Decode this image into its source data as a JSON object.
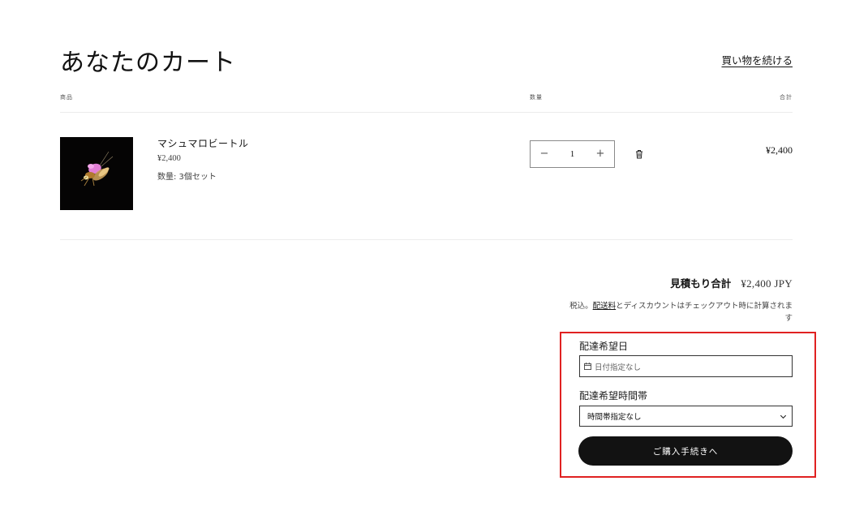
{
  "header": {
    "title": "あなたのカート",
    "continue_link": "買い物を続ける"
  },
  "columns": {
    "product": "商品",
    "quantity": "数量",
    "total": "合計"
  },
  "item": {
    "name": "マシュマロビートル",
    "price": "¥2,400",
    "option": "数量: 3個セット",
    "quantity": "1",
    "decrement_symbol": "−",
    "increment_symbol": "+",
    "line_total": "¥2,400",
    "image_icon": "beetle-photo",
    "remove_icon": "trash-icon"
  },
  "summary": {
    "estimate_label": "見積もり合計",
    "estimate_amount": "¥2,400 JPY",
    "tax_prefix": "税込。",
    "shipping_link": "配送料",
    "tax_suffix": "とディスカウントはチェックアウト時に計算されます"
  },
  "delivery": {
    "date_label": "配達希望日",
    "date_placeholder": "日付指定なし",
    "date_icon": "calendar-icon",
    "time_label": "配達希望時間帯",
    "time_value": "時間帯指定なし",
    "time_icon": "chevron-down-icon"
  },
  "checkout_button": "ご購入手続きへ",
  "colors": {
    "text": "#121212",
    "button_bg": "#121212",
    "highlight_border": "#e02121",
    "divider": "#ececec"
  }
}
